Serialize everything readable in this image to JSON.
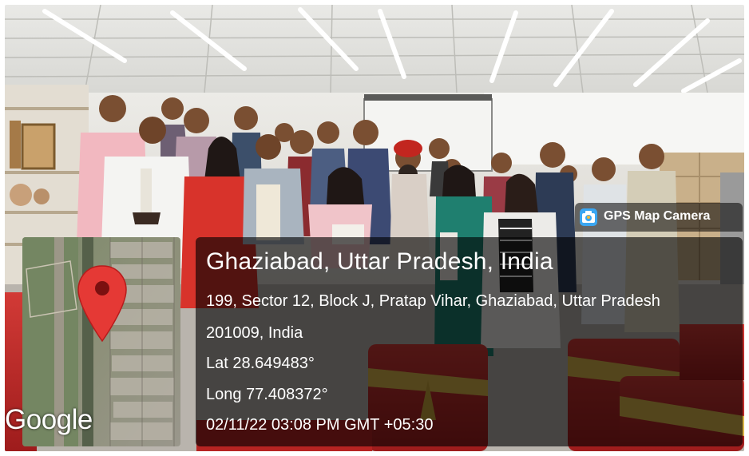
{
  "photo": {
    "description_icon": "group-photo"
  },
  "gps_badge": {
    "label": "GPS Map Camera",
    "icon": "gps-camera-icon"
  },
  "location": {
    "title": "Ghaziabad, Uttar Pradesh, India",
    "address_line1": "199, Sector 12, Block J, Pratap Vihar, Ghaziabad, Uttar Pradesh",
    "address_line2": "201009, India",
    "latitude": "Lat 28.649483°",
    "longitude": "Long 77.408372°",
    "timestamp": "02/11/22 03:08 PM GMT +05:30"
  },
  "map": {
    "provider_logo": "Google",
    "pin_icon": "map-pin-icon",
    "pin_color": "#e53935"
  },
  "colors": {
    "info_panel_bg": "rgba(0,0,0,0.62)",
    "text": "#ffffff",
    "chair_red": "#c62828",
    "sash_gold": "#d9b64a"
  }
}
